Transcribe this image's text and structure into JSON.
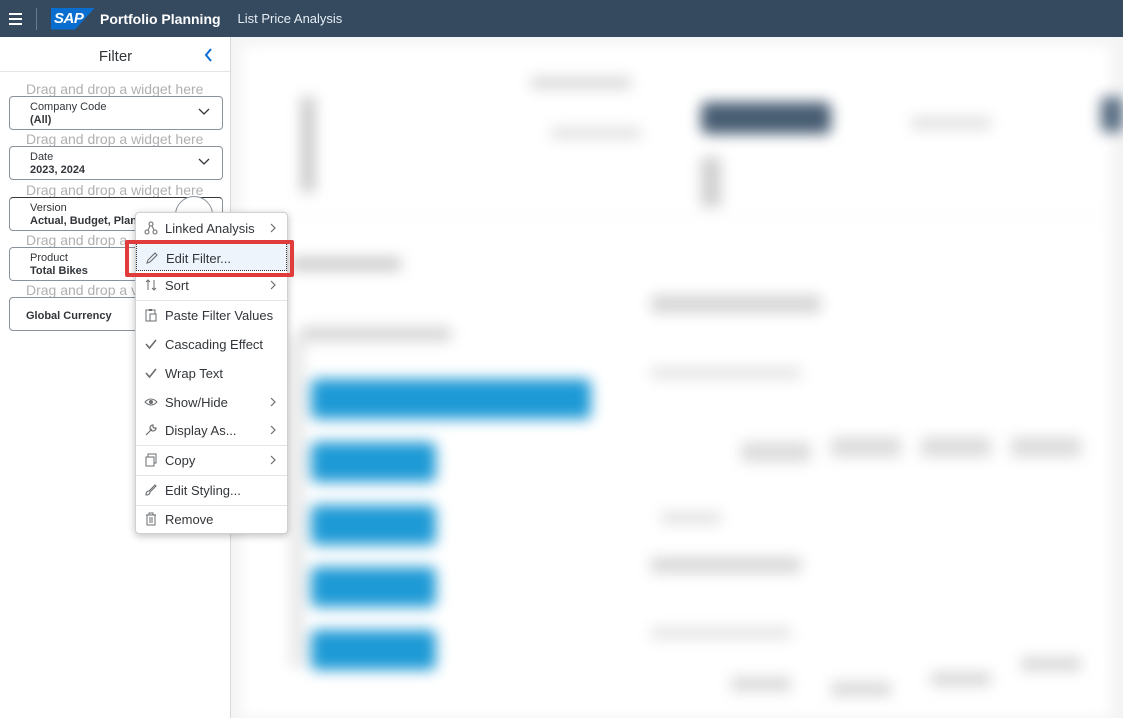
{
  "shell": {
    "logo_text": "SAP",
    "app_title": "Portfolio Planning",
    "story_title": "List Price Analysis"
  },
  "filter_panel": {
    "title": "Filter",
    "drop_hint": "Drag and drop a widget here",
    "drop_hint_cut": "Drag and drop a",
    "drop_hint_cut_short": "Drag and drop a v",
    "filters": [
      {
        "label": "Company Code",
        "value": "(All)"
      },
      {
        "label": "Date",
        "value": "2023, 2024"
      },
      {
        "label": "Version",
        "value": "Actual, Budget, Plan"
      },
      {
        "label": "Product",
        "value": "Total Bikes"
      },
      {
        "label": "",
        "value": "Global Currency"
      }
    ]
  },
  "context_menu": {
    "items": [
      {
        "label": "Linked Analysis",
        "icon": "linked-analysis-icon",
        "submenu": true
      },
      {
        "label": "Edit Filter...",
        "icon": "pencil-icon",
        "submenu": false,
        "highlighted": true
      },
      {
        "label": "Sort",
        "icon": "sort-icon",
        "submenu": true
      },
      {
        "label": "Paste Filter Values",
        "icon": "paste-icon",
        "submenu": false
      },
      {
        "label": "Cascading Effect",
        "icon": "checkmark-icon",
        "submenu": false
      },
      {
        "label": "Wrap Text",
        "icon": "checkmark-icon",
        "submenu": false
      },
      {
        "label": "Show/Hide",
        "icon": "eye-icon",
        "submenu": true
      },
      {
        "label": "Display As...",
        "icon": "wrench-icon",
        "submenu": true
      },
      {
        "label": "Copy",
        "icon": "copy-icon",
        "submenu": true
      },
      {
        "label": "Edit Styling...",
        "icon": "paint-brush-icon",
        "submenu": false
      },
      {
        "label": "Remove",
        "icon": "trash-icon",
        "submenu": false
      }
    ]
  },
  "colors": {
    "shell_bg": "#354a5f",
    "accent_blue": "#1e9ad6",
    "highlight_frame": "#e03c3c"
  }
}
